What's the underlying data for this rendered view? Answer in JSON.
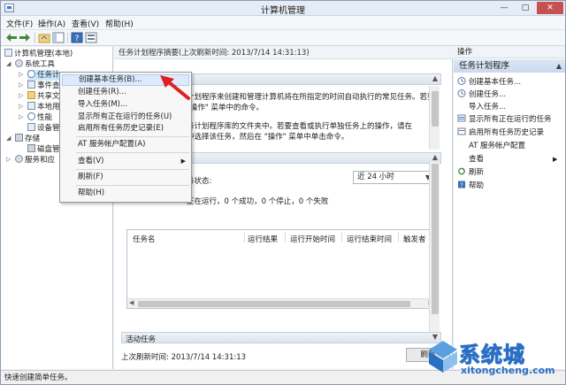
{
  "window": {
    "title": "计算机管理"
  },
  "menubar": [
    "文件(F)",
    "操作(A)",
    "查看(V)",
    "帮助(H)"
  ],
  "tree": {
    "root": "计算机管理(本地)",
    "system_tools": "系统工具",
    "task_scheduler": "任务计",
    "event_viewer": "事件查",
    "shared_folders": "共享文",
    "local_users": "本地用",
    "performance": "性能",
    "device_manager": "设备管",
    "storage": "存储",
    "disk_management": "磁盘管",
    "services_apps": "服务和应"
  },
  "center": {
    "header": "任务计划程序摘要(上次刷新时间: 2013/7/14 14:31:13)",
    "overview_line1": "计划程序来创建和管理计算机将在所指定的时间自动执行的常见任务。若要",
    "overview_line2": "\"操作\" 菜单中的命令。",
    "overview_line3": "务计划程序库的文件夹中。若要查看或执行单独任务上的操作，请在",
    "overview_line4": "中选择该任务，然后在 \"操作\" 菜单中单击命令。",
    "status_label": "务状态:",
    "status_dropdown": "近 24 小时",
    "status_summary": "正在运行，0 个成功，0 个停止，0 个失败",
    "table_headers": [
      "任务名",
      "运行结果",
      "运行开始时间",
      "运行结束时间",
      "触发者"
    ],
    "active_tasks": "活动任务",
    "last_refresh": "上次刷新时间: 2013/7/14 14:31:13",
    "refresh_button": "刷新"
  },
  "actions": {
    "header": "操作",
    "section": "任务计划程序",
    "items": [
      "创建基本任务...",
      "创建任务...",
      "导入任务...",
      "显示所有正在运行的任务",
      "启用所有任务历史记录",
      "AT 服务帐户配置",
      "查看",
      "刷新",
      "帮助"
    ]
  },
  "context_menu": {
    "items": [
      "创建基本任务(B)...",
      "创建任务(R)...",
      "导入任务(M)...",
      "显示所有正在运行的任务(U)",
      "启用所有任务历史记录(E)",
      "AT 服务帐户配置(A)",
      "查看(V)",
      "刷新(F)",
      "帮助(H)"
    ]
  },
  "status_bar": "快速创建简单任务。",
  "watermark": {
    "text": "系统城",
    "url": "xitongcheng.com"
  },
  "colors": {
    "accent": "#2b6fc4",
    "highlight": "#dcebfc",
    "arrow": "#e02020"
  }
}
